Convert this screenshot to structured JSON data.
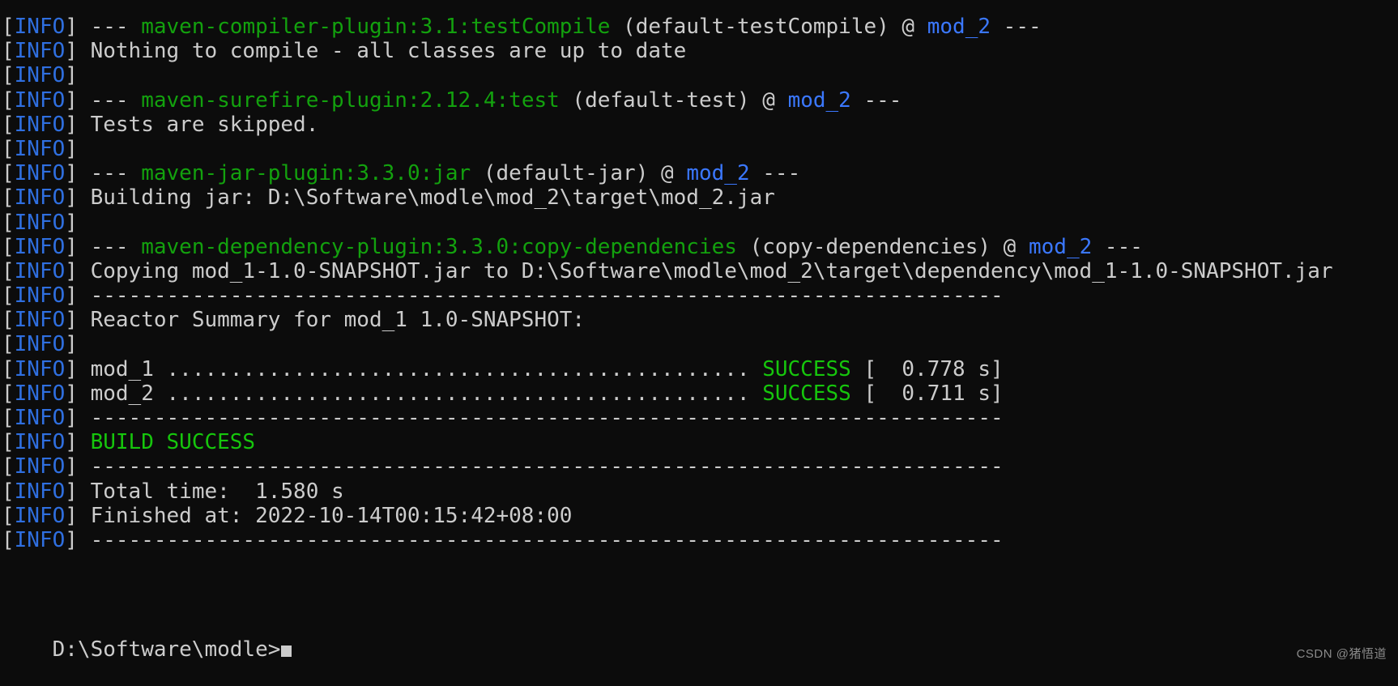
{
  "terminal": {
    "title": "Windows Command Prompt - Maven Build Output",
    "background_color": "#0c0c0c",
    "default_text_color": "#cccccc",
    "colors": {
      "info_blue": "#2f6fe0",
      "plugin_green": "#13a10e",
      "success_green": "#16c60c",
      "module_cyan": "#3b78ff",
      "text_gray": "#cccccc"
    },
    "log_prefix": "[INFO]",
    "log_prefix_bracket_open": "[",
    "log_prefix_level": "INFO",
    "log_prefix_bracket_close": "]",
    "lines": [
      {
        "id": "line-00-clipped",
        "segments": [
          {
            "text": "",
            "color": "text"
          }
        ]
      },
      {
        "id": "line-01-compiler-goal",
        "segments": [
          {
            "text": " --- ",
            "color": "text"
          },
          {
            "text": "maven-compiler-plugin:3.1:testCompile",
            "color": "green"
          },
          {
            "text": " (default-testCompile)",
            "color": "text"
          },
          {
            "text": " @ ",
            "color": "text"
          },
          {
            "text": "mod_2",
            "color": "cyan"
          },
          {
            "text": " ---",
            "color": "text"
          }
        ]
      },
      {
        "id": "line-02-nothing-to-compile",
        "segments": [
          {
            "text": " Nothing to compile - all classes are up to date",
            "color": "text"
          }
        ]
      },
      {
        "id": "line-03-blank",
        "segments": []
      },
      {
        "id": "line-04-surefire-goal",
        "segments": [
          {
            "text": " --- ",
            "color": "text"
          },
          {
            "text": "maven-surefire-plugin:2.12.4:test",
            "color": "green"
          },
          {
            "text": " (default-test)",
            "color": "text"
          },
          {
            "text": " @ ",
            "color": "text"
          },
          {
            "text": "mod_2",
            "color": "cyan"
          },
          {
            "text": " ---",
            "color": "text"
          }
        ]
      },
      {
        "id": "line-05-tests-skipped",
        "segments": [
          {
            "text": " Tests are skipped.",
            "color": "text"
          }
        ]
      },
      {
        "id": "line-06-blank",
        "segments": []
      },
      {
        "id": "line-07-jar-goal",
        "segments": [
          {
            "text": " --- ",
            "color": "text"
          },
          {
            "text": "maven-jar-plugin:3.3.0:jar",
            "color": "green"
          },
          {
            "text": " (default-jar)",
            "color": "text"
          },
          {
            "text": " @ ",
            "color": "text"
          },
          {
            "text": "mod_2",
            "color": "cyan"
          },
          {
            "text": " ---",
            "color": "text"
          }
        ]
      },
      {
        "id": "line-08-building-jar",
        "segments": [
          {
            "text": " Building jar: D:\\Software\\modle\\mod_2\\target\\mod_2.jar",
            "color": "text"
          }
        ]
      },
      {
        "id": "line-09-blank",
        "segments": []
      },
      {
        "id": "line-10-dependency-goal",
        "segments": [
          {
            "text": " --- ",
            "color": "text"
          },
          {
            "text": "maven-dependency-plugin:3.3.0:copy-dependencies",
            "color": "green"
          },
          {
            "text": " (copy-dependencies)",
            "color": "text"
          },
          {
            "text": " @ ",
            "color": "text"
          },
          {
            "text": "mod_2",
            "color": "cyan"
          },
          {
            "text": " ---",
            "color": "text"
          }
        ]
      },
      {
        "id": "line-11-copying",
        "segments": [
          {
            "text": " Copying mod_1-1.0-SNAPSHOT.jar to D:\\Software\\modle\\mod_2\\target\\dependency\\mod_1-1.0-SNAPSHOT.jar",
            "color": "text"
          }
        ]
      },
      {
        "id": "line-12-separator",
        "segments": [
          {
            "text": " ------------------------------------------------------------------------",
            "color": "text"
          }
        ]
      },
      {
        "id": "line-13-reactor-summary",
        "segments": [
          {
            "text": " Reactor Summary for mod_1 1.0-SNAPSHOT:",
            "color": "text"
          }
        ]
      },
      {
        "id": "line-14-blank",
        "segments": []
      },
      {
        "id": "line-15-mod1-result",
        "segments": [
          {
            "text": " mod_1 .............................................. ",
            "color": "text"
          },
          {
            "text": "SUCCESS",
            "color": "success"
          },
          {
            "text": " [  0.778 s]",
            "color": "text"
          }
        ]
      },
      {
        "id": "line-16-mod2-result",
        "segments": [
          {
            "text": " mod_2 .............................................. ",
            "color": "text"
          },
          {
            "text": "SUCCESS",
            "color": "success"
          },
          {
            "text": " [  0.711 s]",
            "color": "text"
          }
        ]
      },
      {
        "id": "line-17-separator",
        "segments": [
          {
            "text": " ------------------------------------------------------------------------",
            "color": "text"
          }
        ]
      },
      {
        "id": "line-18-build-success",
        "segments": [
          {
            "text": " BUILD SUCCESS",
            "color": "success"
          }
        ]
      },
      {
        "id": "line-19-separator",
        "segments": [
          {
            "text": " ------------------------------------------------------------------------",
            "color": "text"
          }
        ]
      },
      {
        "id": "line-20-total-time",
        "segments": [
          {
            "text": " Total time:  1.580 s",
            "color": "text"
          }
        ]
      },
      {
        "id": "line-21-finished-at",
        "segments": [
          {
            "text": " Finished at: 2022-10-14T00:15:42+08:00",
            "color": "text"
          }
        ]
      },
      {
        "id": "line-22-separator",
        "segments": [
          {
            "text": " ------------------------------------------------------------------------",
            "color": "text"
          }
        ]
      }
    ],
    "prompt": {
      "path": "D:\\Software\\modle",
      "symbol": ">",
      "input_value": ""
    },
    "watermark": "CSDN @猪悟道"
  }
}
